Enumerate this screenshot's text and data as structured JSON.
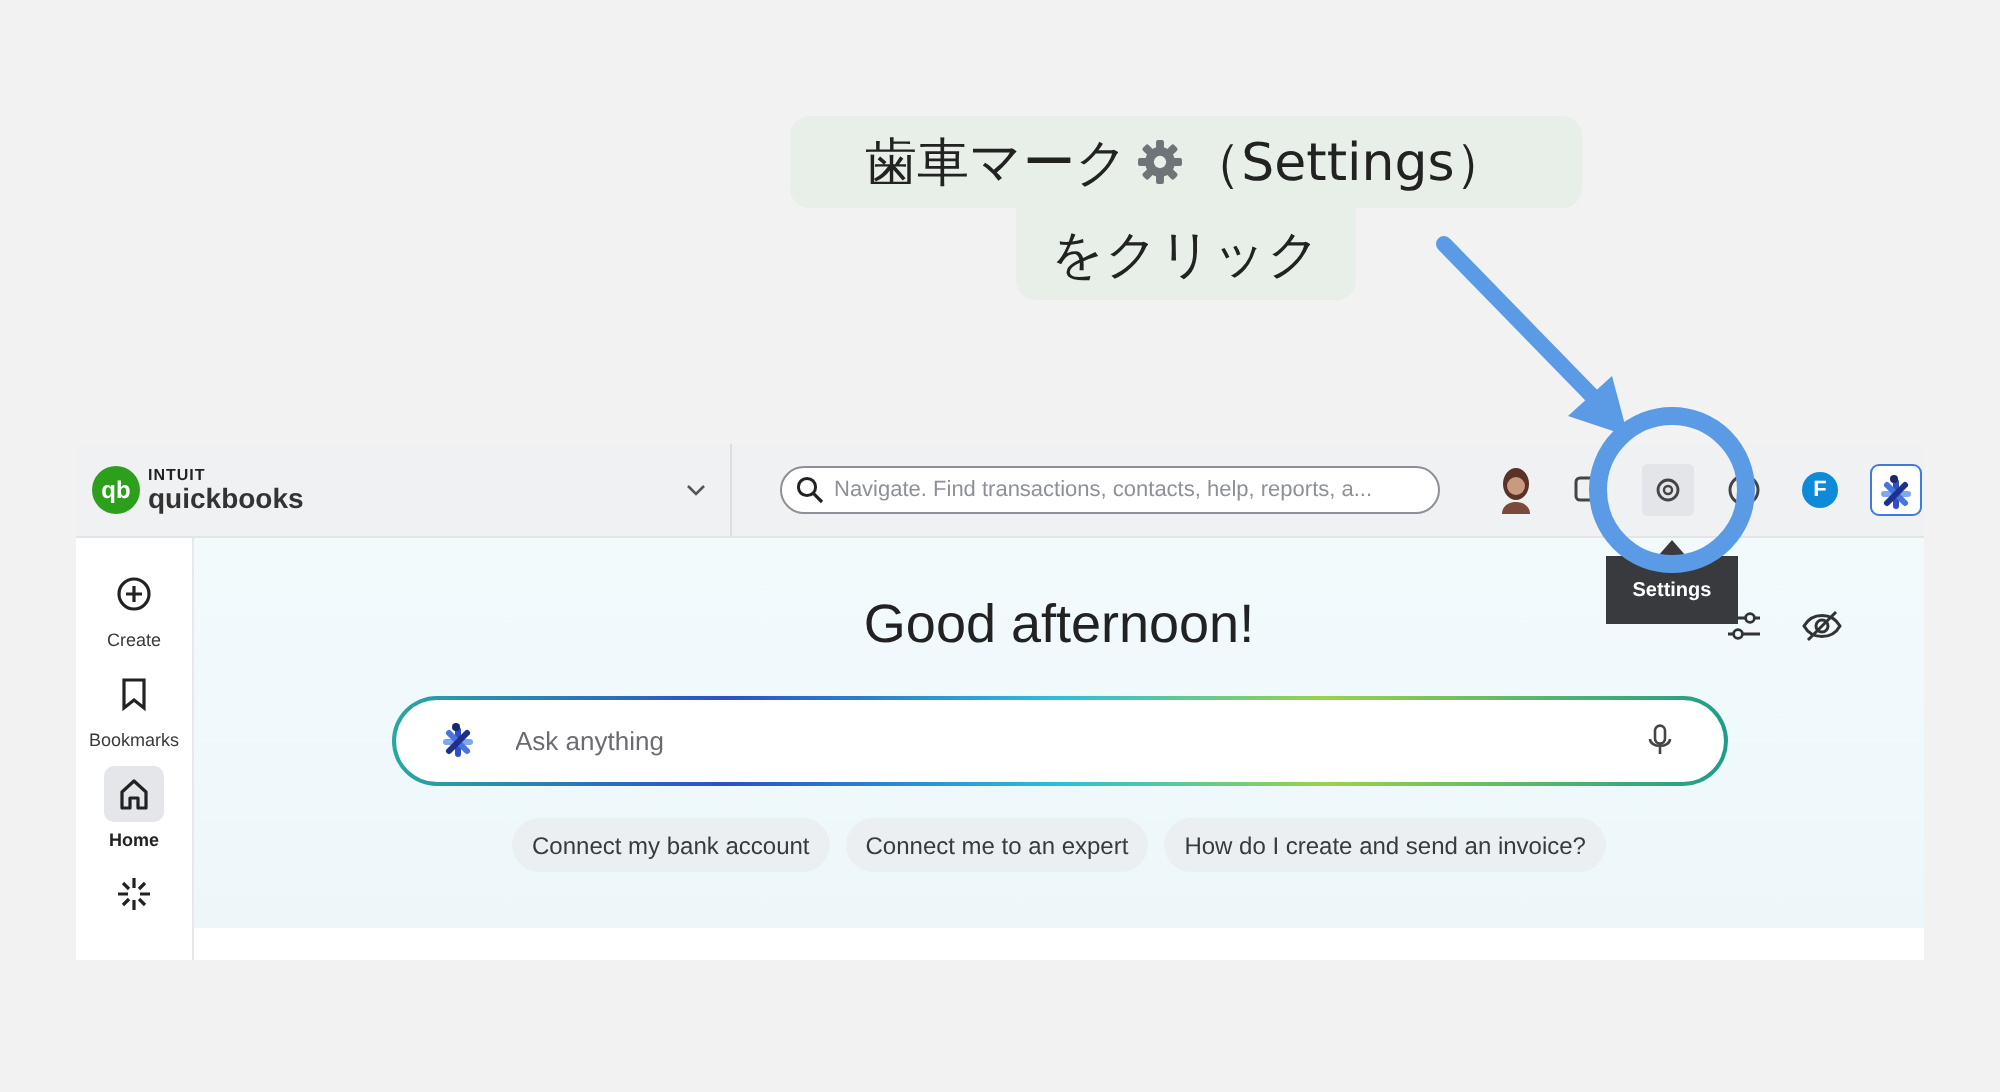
{
  "callout": {
    "text_before": "歯車マーク",
    "text_after": "（Settings）",
    "line_2": "をクリック"
  },
  "header": {
    "logo_brand": "INTUIT",
    "logo_mark": "qb",
    "logo_product": "quickbooks",
    "search": {
      "placeholder": "Navigate. Find transactions, contacts, help, reports, a..."
    },
    "profile_initial": "F"
  },
  "tooltip": {
    "text": "Settings"
  },
  "sidebar": {
    "items": [
      {
        "kind": "create",
        "label": "Create",
        "selected": false
      },
      {
        "kind": "bookmark",
        "label": "Bookmarks",
        "selected": false
      },
      {
        "kind": "home",
        "label": "Home",
        "selected": true
      },
      {
        "kind": "sparkle",
        "selected": false
      }
    ]
  },
  "main": {
    "greeting": "Good afternoon!",
    "ask": {
      "placeholder": "Ask anything"
    },
    "suggestions": [
      "Connect my bank account",
      "Connect me to an expert",
      "How do I create and send an invoice?"
    ]
  }
}
